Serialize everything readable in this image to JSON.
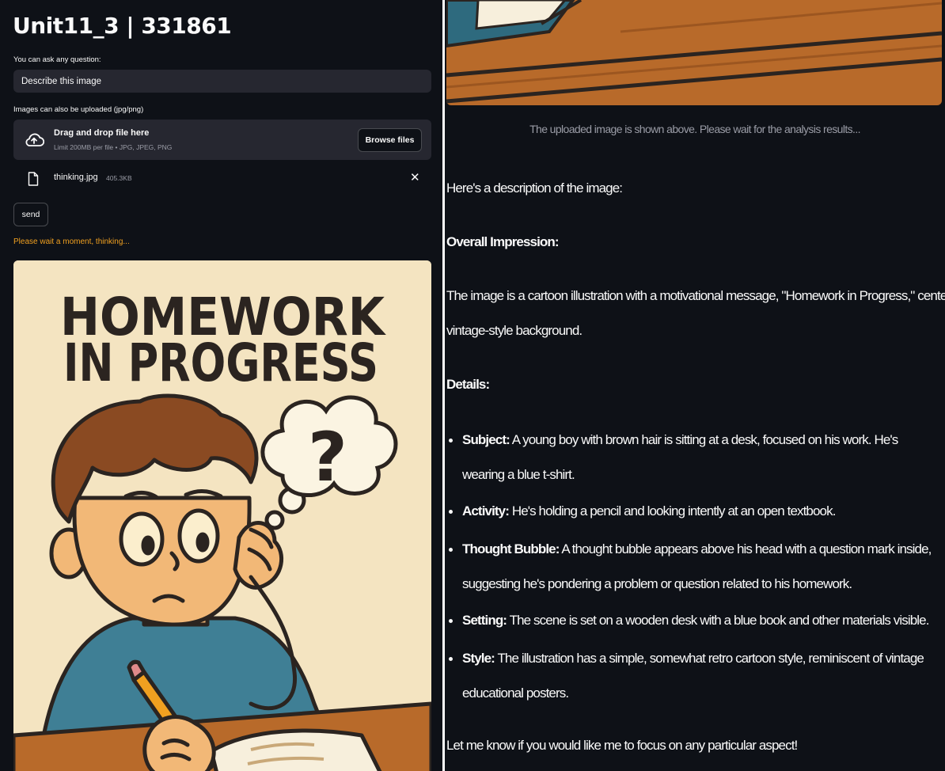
{
  "app": {
    "title": "Unit11_3 | 331861"
  },
  "question": {
    "label": "You can ask any question:",
    "value": "Describe this image"
  },
  "upload": {
    "label": "Images can also be uploaded  (jpg/png)",
    "drop_title": "Drag and drop file here",
    "drop_limit": "Limit 200MB per file • JPG, JPEG, PNG",
    "browse_label": "Browse files",
    "file_name": "thinking.jpg",
    "file_size": "405.3KB",
    "remove_glyph": "✕"
  },
  "send_label": "send",
  "status": "Please wait a moment, thinking...",
  "poster": {
    "line1": "HOMEWORK",
    "line2": "IN PROGRESS",
    "bubble_mark": "?"
  },
  "icons": [
    "upload-cloud-icon",
    "file-icon",
    "close-icon",
    "bullet-icon"
  ],
  "colors": {
    "background": "#0e1117",
    "input_bg": "#262730",
    "status": "#f0a020",
    "poster_bg": "#f4e4c1",
    "desk": "#b86a2a"
  },
  "response": {
    "caption": "The uploaded image is shown above. Please wait for the analysis results...",
    "intro": "Here's a description of the image:",
    "overall_heading": "Overall Impression:",
    "overall_text_1": "The image is a cartoon illustration with a motivational message, \"Homework in Progress,\" centered in a",
    "overall_text_2": "vintage-style background.",
    "details_heading": "Details:",
    "details": [
      {
        "label": "Subject:",
        "text": "A young boy with brown hair is sitting at a desk, focused on his work. He's wearing a blue t-shirt."
      },
      {
        "label": "Activity:",
        "text": "He's holding a pencil and looking intently at an open textbook."
      },
      {
        "label": "Thought Bubble:",
        "text": "A thought bubble appears above his head with a question mark inside, suggesting he's pondering a problem or question related to his homework."
      },
      {
        "label": "Setting:",
        "text": "The scene is set on a wooden desk with a blue book and other materials visible."
      },
      {
        "label": "Style:",
        "text": "The illustration has a simple, somewhat retro cartoon style, reminiscent of vintage educational posters."
      }
    ],
    "closing": "Let me know if you would like me to focus on any particular aspect!"
  }
}
